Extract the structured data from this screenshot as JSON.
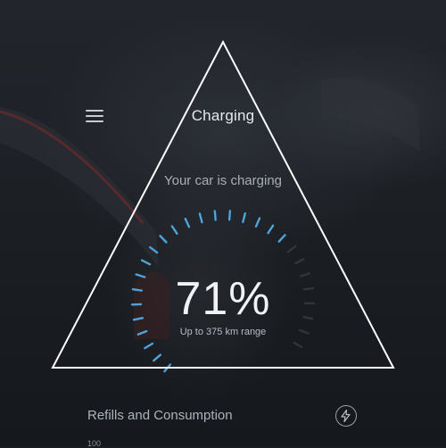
{
  "header": {
    "title": "Charging",
    "menu_icon": "hamburger-icon"
  },
  "status": {
    "message": "Your car is charging",
    "percent_label": "71%",
    "charge_fraction": 0.71,
    "range_label": "Up to 375 km range"
  },
  "consumption": {
    "label": "Refills and Consumption",
    "action_icon": "lightning-icon",
    "axis_value": "100"
  },
  "colors": {
    "accent": "#4fa3d9",
    "overlay_line": "#ffffff"
  }
}
